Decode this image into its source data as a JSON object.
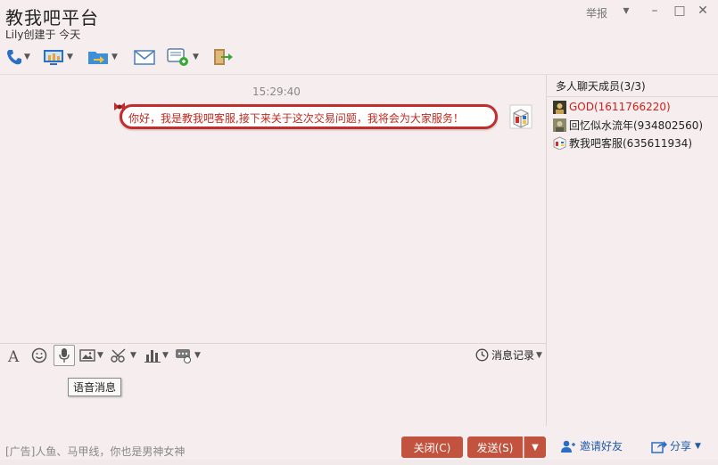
{
  "window": {
    "title": "教我吧平台",
    "subtitle": "Lily创建于 今天",
    "report_label": "举报"
  },
  "toolbar": {
    "icons": [
      "phone-icon",
      "screen-share-icon",
      "file-transfer-icon",
      "mail-icon",
      "note-add-icon",
      "exit-icon"
    ]
  },
  "chat": {
    "timestamp": "15:29:40",
    "message": "你好，我是教我吧客服,接下来关于这次交易问题，我将会为大家服务！"
  },
  "members": {
    "title": "多人聊天成员(3/3)",
    "list": [
      {
        "name": "GOD(1611766220)",
        "color": "#d0201a"
      },
      {
        "name": "回忆似水流年(934802560)",
        "color": "#222222"
      },
      {
        "name": "教我吧客服(635611934)",
        "color": "#222222"
      }
    ]
  },
  "input_toolbar": {
    "tooltip": "语音消息",
    "history_label": "消息记录"
  },
  "bottom": {
    "ad": "[广告]人鱼、马甲线，你也是男神女神",
    "close_label": "关闭(C)",
    "send_label": "发送(S)",
    "invite_label": "邀请好友",
    "share_label": "分享"
  },
  "colors": {
    "accent_red": "#c2533e",
    "bubble_border": "#c22e2e",
    "link_blue": "#1f5aa8"
  }
}
